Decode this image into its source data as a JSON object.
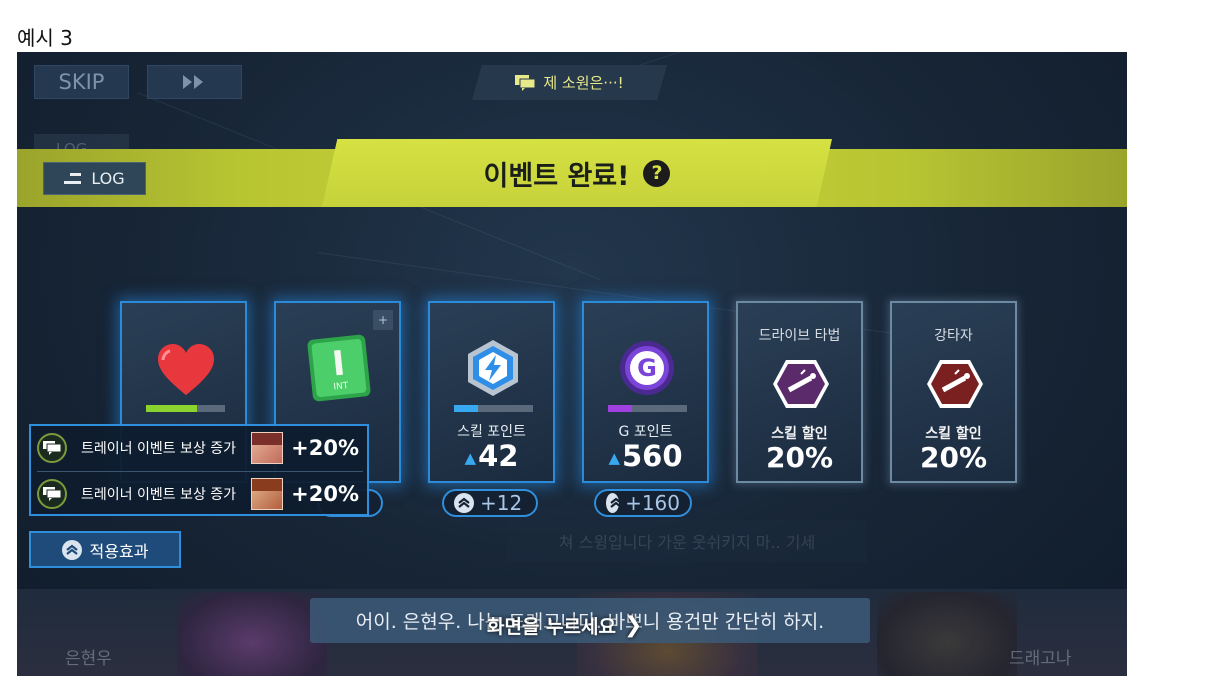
{
  "caption": "예시 3",
  "top": {
    "skip_label": "SKIP",
    "fast_forward_icon": "double-chevron-right-icon",
    "speech_chip": "제 소원은···!",
    "ghost_log": "LOG"
  },
  "banner": {
    "title": "이벤트 완료!",
    "help": "?",
    "log_label": "LOG"
  },
  "cards": [
    {
      "kind": "heart",
      "icon": "heart-icon",
      "bar_fill": 0.65,
      "bar_color": "#8bd32f"
    },
    {
      "kind": "stat",
      "icon": "int-stat-icon",
      "icon_letter": "I",
      "icon_sub": "INT",
      "zoom": "+"
    },
    {
      "kind": "skill-point",
      "icon": "lightning-badge-icon",
      "bar_fill": 0.3,
      "bar_color": "#38a8f0",
      "label": "스킬 포인트",
      "value": "42",
      "pill": "+12"
    },
    {
      "kind": "g-point",
      "icon": "g-coin-icon",
      "icon_letter": "G",
      "bar_fill": 0.3,
      "bar_color": "#a040e0",
      "label": "G 포인트",
      "value": "560",
      "pill": "+160"
    },
    {
      "kind": "discount",
      "icon": "drive-hit-hexagon-icon",
      "title": "드라이브 타법",
      "sub": "스킬 할인",
      "value": "20%",
      "hex_color": "#5a2a6a"
    },
    {
      "kind": "discount",
      "icon": "power-hitter-hexagon-icon",
      "title": "강타자",
      "sub": "스킬 할인",
      "value": "20%",
      "hex_color": "#7a2020"
    }
  ],
  "bonus": {
    "rows": [
      {
        "text": "트레이너 이벤트 보상 증가",
        "pct": "+20%"
      },
      {
        "text": "트레이너 이벤트 보상 증가",
        "pct": "+20%"
      }
    ]
  },
  "apply_button": "적용효과",
  "ghost_text": "쳐 스윙입니다 가운 웃쉬키지 마.. 기세",
  "dialogue": {
    "line": "어이. 은현우. 나는 드래고나다. 바쁘니 용건만 간단히 하지.",
    "tap": "화면을 누르세요",
    "left_name": "은현우",
    "right_name": "드래고나"
  },
  "colors": {
    "banner": "#c8d33a",
    "card_glow": "#2c8bd8",
    "bonus_border": "#2f8fdc"
  }
}
